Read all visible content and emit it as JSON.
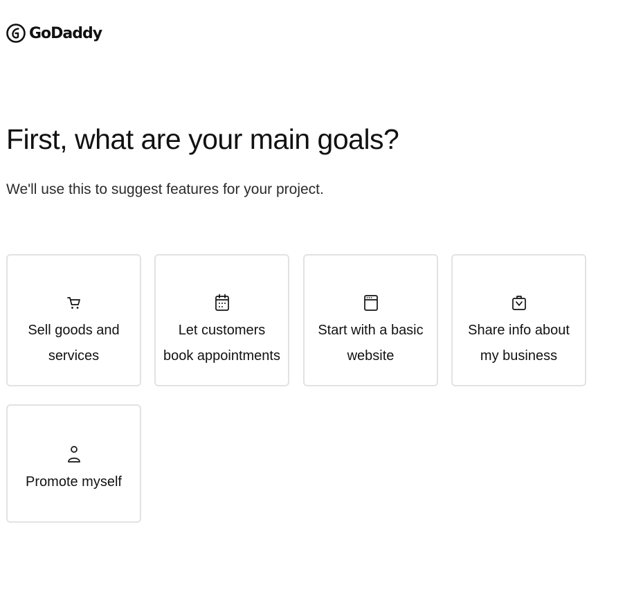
{
  "brand": {
    "name": "GoDaddy"
  },
  "heading": {
    "title": "First, what are your main goals?",
    "subtitle": "We'll use this to suggest features for your project."
  },
  "goals": [
    {
      "label": "Sell goods and services",
      "icon": "shopping-cart-icon"
    },
    {
      "label": "Let customers book appointments",
      "icon": "calendar-icon"
    },
    {
      "label": "Start with a basic website",
      "icon": "browser-window-icon"
    },
    {
      "label": "Share info about my business",
      "icon": "briefcase-icon"
    },
    {
      "label": "Promote myself",
      "icon": "person-icon"
    }
  ],
  "colors": {
    "text": "#111111",
    "card_border": "#e2e2e2",
    "background": "#ffffff"
  }
}
